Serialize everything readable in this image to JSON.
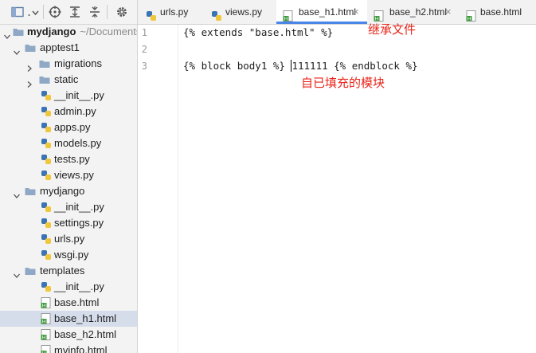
{
  "toolbar": {
    "icons": [
      "project-view-icon",
      "dropdown-icon",
      "locate-icon",
      "expand-all-icon",
      "collapse-all-icon",
      "settings-icon"
    ]
  },
  "project_tree": {
    "root_name": "mydjango",
    "root_path": "~/Documents",
    "items": [
      {
        "label": "apptest1",
        "type": "folder",
        "expanded": true
      },
      {
        "label": "migrations",
        "type": "folder",
        "expanded": false
      },
      {
        "label": "static",
        "type": "folder",
        "expanded": false
      },
      {
        "label": "__init__.py",
        "type": "python"
      },
      {
        "label": "admin.py",
        "type": "python"
      },
      {
        "label": "apps.py",
        "type": "python"
      },
      {
        "label": "models.py",
        "type": "python"
      },
      {
        "label": "tests.py",
        "type": "python"
      },
      {
        "label": "views.py",
        "type": "python"
      },
      {
        "label": "mydjango",
        "type": "folder",
        "expanded": true
      },
      {
        "label": "__init__.py",
        "type": "python"
      },
      {
        "label": "settings.py",
        "type": "python"
      },
      {
        "label": "urls.py",
        "type": "python"
      },
      {
        "label": "wsgi.py",
        "type": "python"
      },
      {
        "label": "templates",
        "type": "folder",
        "expanded": true
      },
      {
        "label": "__init__.py",
        "type": "python"
      },
      {
        "label": "base.html",
        "type": "html"
      },
      {
        "label": "base_h1.html",
        "type": "html",
        "selected": true
      },
      {
        "label": "base_h2.html",
        "type": "html"
      },
      {
        "label": "myinfo.html",
        "type": "html"
      }
    ]
  },
  "tabs": [
    {
      "label": "urls.py",
      "type": "python",
      "active": false
    },
    {
      "label": "views.py",
      "type": "python",
      "active": false
    },
    {
      "label": "base_h1.html",
      "type": "html",
      "active": true
    },
    {
      "label": "base_h2.html",
      "type": "html",
      "active": false
    },
    {
      "label": "base.html",
      "type": "html",
      "active": false
    }
  ],
  "tab_close_symbol": "×",
  "editor": {
    "line_numbers": [
      "1",
      "2",
      "3"
    ],
    "lines": [
      {
        "before_caret": "{% extends \"base.html\" %}",
        "after_caret": ""
      },
      {
        "before_caret": "",
        "after_caret": ""
      },
      {
        "before_caret": "{% block body1 %} ",
        "after_caret": "111111 {% endblock %}"
      }
    ]
  },
  "annotations": {
    "inherit_file": "继承文件",
    "own_filled_block": "自已填充的模块"
  },
  "colors": {
    "annotation": "#e8241a",
    "selection": "#d5dcea",
    "tab_accent": "#4a86e8",
    "folder": "#8ea8c6",
    "python_blue": "#3b73b4",
    "python_yellow": "#f0c73b",
    "html_green": "#3f9b3f"
  }
}
